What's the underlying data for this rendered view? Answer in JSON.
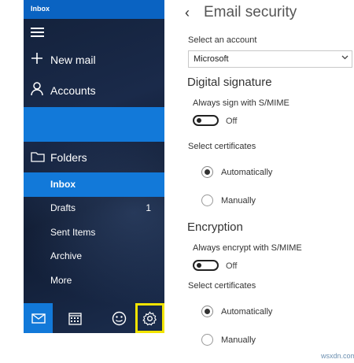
{
  "window": {
    "title": "Inbox"
  },
  "nav": {
    "new_mail": "New mail",
    "accounts": "Accounts",
    "folders": "Folders",
    "folder_items": [
      {
        "label": "Inbox",
        "count": "",
        "active": true
      },
      {
        "label": "Drafts",
        "count": "1",
        "active": false
      },
      {
        "label": "Sent Items",
        "count": "",
        "active": false
      },
      {
        "label": "Archive",
        "count": "",
        "active": false
      },
      {
        "label": "More",
        "count": "",
        "active": false
      }
    ],
    "bottom_icons": [
      "mail-icon",
      "calendar-icon",
      "smiley-icon",
      "gear-icon"
    ]
  },
  "settings": {
    "back_glyph": "‹",
    "title": "Email security",
    "select_account_label": "Select an account",
    "account_value": "Microsoft",
    "digital_signature": {
      "heading": "Digital signature",
      "toggle_label": "Always sign with S/MIME",
      "toggle_state": "Off",
      "cert_label": "Select certificates",
      "options": [
        "Automatically",
        "Manually"
      ],
      "selected": "Automatically"
    },
    "encryption": {
      "heading": "Encryption",
      "toggle_label": "Always encrypt with S/MIME",
      "toggle_state": "Off",
      "cert_label": "Select certificates",
      "options": [
        "Automatically",
        "Manually"
      ],
      "selected": "Automatically"
    }
  },
  "watermark": "wsxdn.com",
  "colors": {
    "accent": "#1279d9",
    "titlebar": "#0a63c2",
    "highlight": "#f2e400"
  }
}
